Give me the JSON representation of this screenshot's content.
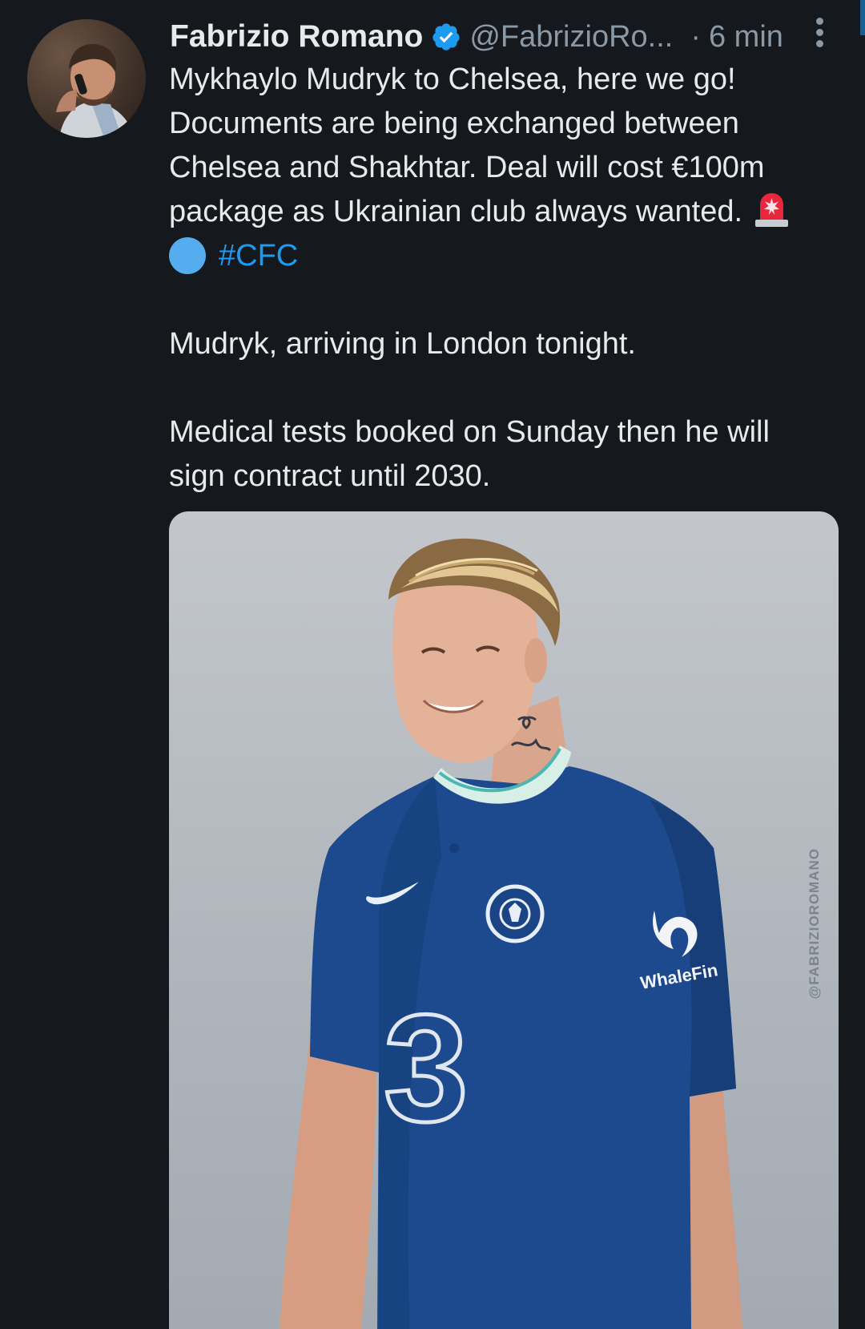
{
  "author": {
    "display_name": "Fabrizio Romano",
    "handle": "@FabrizioRo...",
    "separator": "·",
    "time": "6 min"
  },
  "icons": {
    "verified": "verified-badge-icon",
    "more": "more-options-icon",
    "alarm": "police-car-light-emoji",
    "blue_circle": "blue-circle-emoji"
  },
  "colors": {
    "background": "#15181c",
    "text": "#e7e9ea",
    "secondary": "#8b98a5",
    "accent": "#1d9bf0"
  },
  "tweet": {
    "lines": [
      "Mykhaylo Mudryk to Chelsea, here we go!",
      "Documents are being exchanged between",
      "Chelsea and Shakhtar. Deal will cost €100m",
      "package as Ukrainian club always wanted."
    ],
    "hashtag": "#CFC",
    "paragraph2": "Mudryk, arriving in London tonight.",
    "paragraph3_lines": [
      "Medical tests booked on Sunday then he will",
      "sign contract until 2030."
    ]
  },
  "media": {
    "watermark": "@FABRIZIOROMANO",
    "sponsor": "WhaleFin",
    "number": "3"
  }
}
